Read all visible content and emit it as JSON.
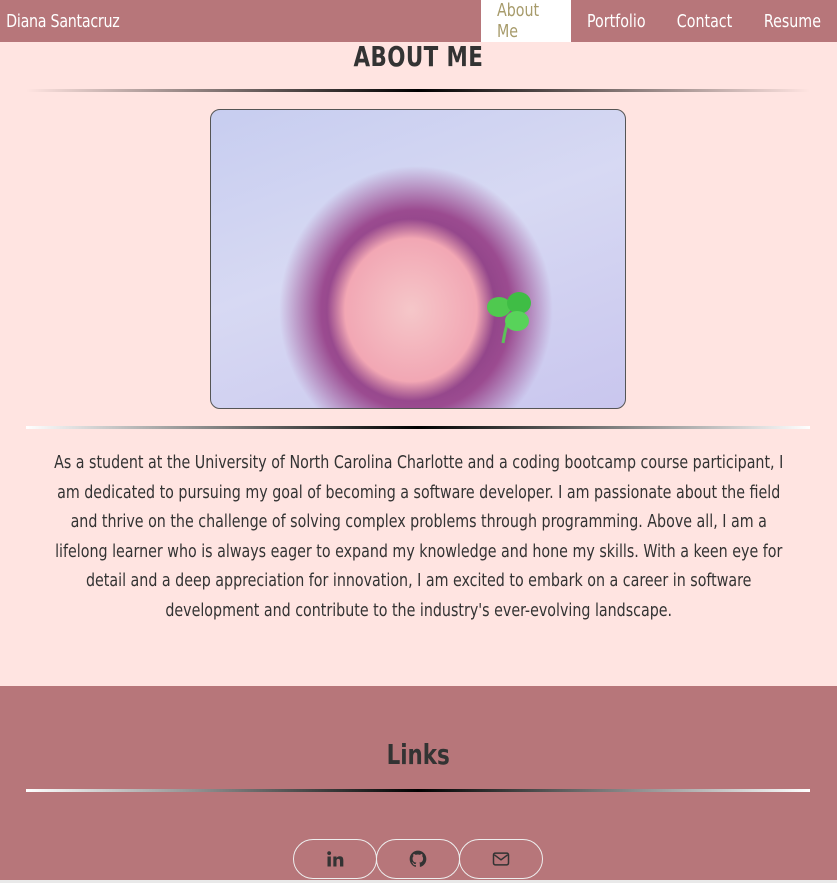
{
  "navbar": {
    "brand": "Diana Santacruz",
    "links": [
      {
        "label": "About Me",
        "active": true
      },
      {
        "label": "Portfolio",
        "active": false
      },
      {
        "label": "Contact",
        "active": false
      },
      {
        "label": "Resume",
        "active": false
      }
    ]
  },
  "about": {
    "title": "ABOUT ME",
    "photo_icon": "profile-photo",
    "text": "As a student at the University of North Carolina Charlotte and a coding bootcamp course participant, I am dedicated to pursuing my goal of becoming a software developer. I am passionate about the field and thrive on the challenge of solving complex problems through programming. Above all, I am a lifelong learner who is always eager to expand my knowledge and hone my skills. With a keen eye for detail and a deep appreciation for innovation, I am excited to embark on a career in software development and contribute to the industry's ever-evolving landscape."
  },
  "footer": {
    "title": "Links",
    "social": [
      {
        "icon": "linkedin-icon"
      },
      {
        "icon": "github-icon"
      },
      {
        "icon": "envelope-icon"
      }
    ]
  },
  "colors": {
    "nav_bg": "#b7767a",
    "page_bg": "#ffe4e1",
    "active_text": "#a79b6b"
  }
}
